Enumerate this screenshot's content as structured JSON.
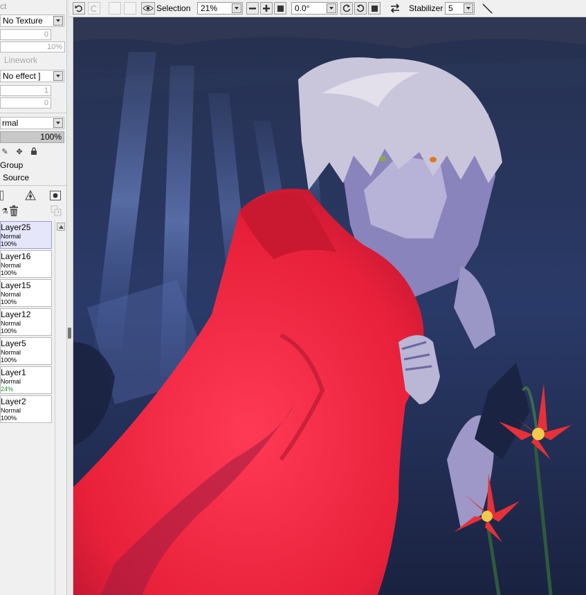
{
  "left_panel": {
    "texture_select": "No Texture",
    "texture_scale": "0",
    "texture_strength": "10%",
    "linework_label": "Linework",
    "effect_select": "No effect ]",
    "effect_width": "1",
    "effect_strength": "0",
    "blend_mode": "rmal",
    "opacity": "100%",
    "clipping_group_label": "Group",
    "selection_source_label": "Source",
    "partial_title": "ct"
  },
  "layers": [
    {
      "name": "Layer25",
      "mode": "Normal",
      "opacity": "100%",
      "selected": true
    },
    {
      "name": "Layer16",
      "mode": "Normal",
      "opacity": "100%"
    },
    {
      "name": "Layer15",
      "mode": "Normal",
      "opacity": "100%"
    },
    {
      "name": "Layer12",
      "mode": "Normal",
      "opacity": "100%"
    },
    {
      "name": "Layer5",
      "mode": "Normal",
      "opacity": "100%"
    },
    {
      "name": "Layer1",
      "mode": "Normal",
      "opacity": "24%"
    },
    {
      "name": "Layer2",
      "mode": "Normal",
      "opacity": "100%"
    }
  ],
  "toolbar": {
    "selection_label": "Selection",
    "zoom_value": "21%",
    "rotation_value": "0.0°",
    "stabilizer_label": "Stabilizer",
    "stabilizer_value": "5"
  },
  "colors": {
    "cloak_red": "#e8203a",
    "night_blue": "#1e2746",
    "selected_layer": "#e6e6fa",
    "partial_opacity_text": "#1d8a2e"
  }
}
